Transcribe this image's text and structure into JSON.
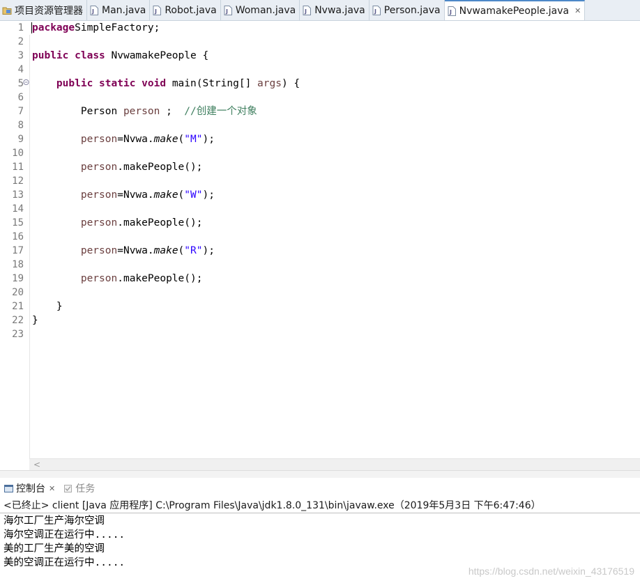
{
  "tabs": [
    {
      "label": "项目资源管理器",
      "icon": "project-explorer-icon",
      "active": false
    },
    {
      "label": "Man.java",
      "icon": "java-file-icon",
      "active": false
    },
    {
      "label": "Robot.java",
      "icon": "java-file-icon",
      "active": false
    },
    {
      "label": "Woman.java",
      "icon": "java-file-icon",
      "active": false
    },
    {
      "label": "Nvwa.java",
      "icon": "java-file-icon",
      "active": false
    },
    {
      "label": "Person.java",
      "icon": "java-file-icon",
      "active": false
    },
    {
      "label": "NvwamakePeople.java",
      "icon": "java-file-icon",
      "active": true,
      "close": "✕"
    }
  ],
  "editor": {
    "lines": [
      {
        "n": "1",
        "tokens": [
          [
            "kw",
            "package"
          ],
          [
            "",
            "SimpleFactory;"
          ]
        ]
      },
      {
        "n": "2",
        "tokens": []
      },
      {
        "n": "3",
        "tokens": [
          [
            "kw",
            "public"
          ],
          [
            "",
            " "
          ],
          [
            "kw",
            "class"
          ],
          [
            "",
            " NvwamakePeople {"
          ]
        ]
      },
      {
        "n": "4",
        "tokens": []
      },
      {
        "n": "5",
        "tokens": [
          [
            "",
            "    "
          ],
          [
            "kw",
            "public"
          ],
          [
            "",
            " "
          ],
          [
            "kw",
            "static"
          ],
          [
            "",
            " "
          ],
          [
            "kw",
            "void"
          ],
          [
            "",
            " main(String[] "
          ],
          [
            "var",
            "args"
          ],
          [
            "",
            ") {"
          ]
        ]
      },
      {
        "n": "6",
        "tokens": []
      },
      {
        "n": "7",
        "tokens": [
          [
            "",
            "        Person "
          ],
          [
            "var",
            "person"
          ],
          [
            "",
            " ;  "
          ],
          [
            "com",
            "//创建一个对象"
          ]
        ]
      },
      {
        "n": "8",
        "tokens": []
      },
      {
        "n": "9",
        "tokens": [
          [
            "",
            "        "
          ],
          [
            "var",
            "person"
          ],
          [
            "",
            "=Nvwa."
          ],
          [
            "it",
            "make"
          ],
          [
            "",
            "("
          ],
          [
            "str",
            "\"M\""
          ],
          [
            "",
            ");"
          ]
        ]
      },
      {
        "n": "10",
        "tokens": []
      },
      {
        "n": "11",
        "tokens": [
          [
            "",
            "        "
          ],
          [
            "var",
            "person"
          ],
          [
            "",
            ".makePeople();"
          ]
        ]
      },
      {
        "n": "12",
        "tokens": []
      },
      {
        "n": "13",
        "tokens": [
          [
            "",
            "        "
          ],
          [
            "var",
            "person"
          ],
          [
            "",
            "=Nvwa."
          ],
          [
            "it",
            "make"
          ],
          [
            "",
            "("
          ],
          [
            "str",
            "\"W\""
          ],
          [
            "",
            ");"
          ]
        ]
      },
      {
        "n": "14",
        "tokens": []
      },
      {
        "n": "15",
        "tokens": [
          [
            "",
            "        "
          ],
          [
            "var",
            "person"
          ],
          [
            "",
            ".makePeople();"
          ]
        ]
      },
      {
        "n": "16",
        "tokens": []
      },
      {
        "n": "17",
        "tokens": [
          [
            "",
            "        "
          ],
          [
            "var",
            "person"
          ],
          [
            "",
            "=Nvwa."
          ],
          [
            "it",
            "make"
          ],
          [
            "",
            "("
          ],
          [
            "str",
            "\"R\""
          ],
          [
            "",
            ");"
          ]
        ]
      },
      {
        "n": "18",
        "tokens": []
      },
      {
        "n": "19",
        "tokens": [
          [
            "",
            "        "
          ],
          [
            "var",
            "person"
          ],
          [
            "",
            ".makePeople();"
          ]
        ]
      },
      {
        "n": "20",
        "tokens": []
      },
      {
        "n": "21",
        "tokens": [
          [
            "",
            "    }"
          ]
        ]
      },
      {
        "n": "22",
        "tokens": [
          [
            "",
            "}"
          ]
        ]
      },
      {
        "n": "23",
        "tokens": []
      }
    ]
  },
  "scroll_arrow": "<",
  "panel": {
    "tabs": [
      {
        "label": "控制台",
        "icon": "console-icon",
        "close": "✕",
        "active": true
      },
      {
        "label": "任务",
        "icon": "tasks-icon",
        "active": false
      }
    ],
    "header": "<已终止> client [Java 应用程序] C:\\Program Files\\Java\\jdk1.8.0_131\\bin\\javaw.exe（2019年5月3日 下午6:47:46）",
    "output": [
      "海尔工厂生产海尔空调",
      "海尔空调正在运行中.....",
      "美的工厂生产美的空调",
      "美的空调正在运行中....."
    ]
  },
  "watermark": "https://blog.csdn.net/weixin_43176519",
  "colors": {
    "keyword": "#7f0055",
    "variable": "#6a3e3e",
    "string": "#2a00ff",
    "comment": "#3f7f5f",
    "active_tab_accent": "#4d88c8"
  }
}
